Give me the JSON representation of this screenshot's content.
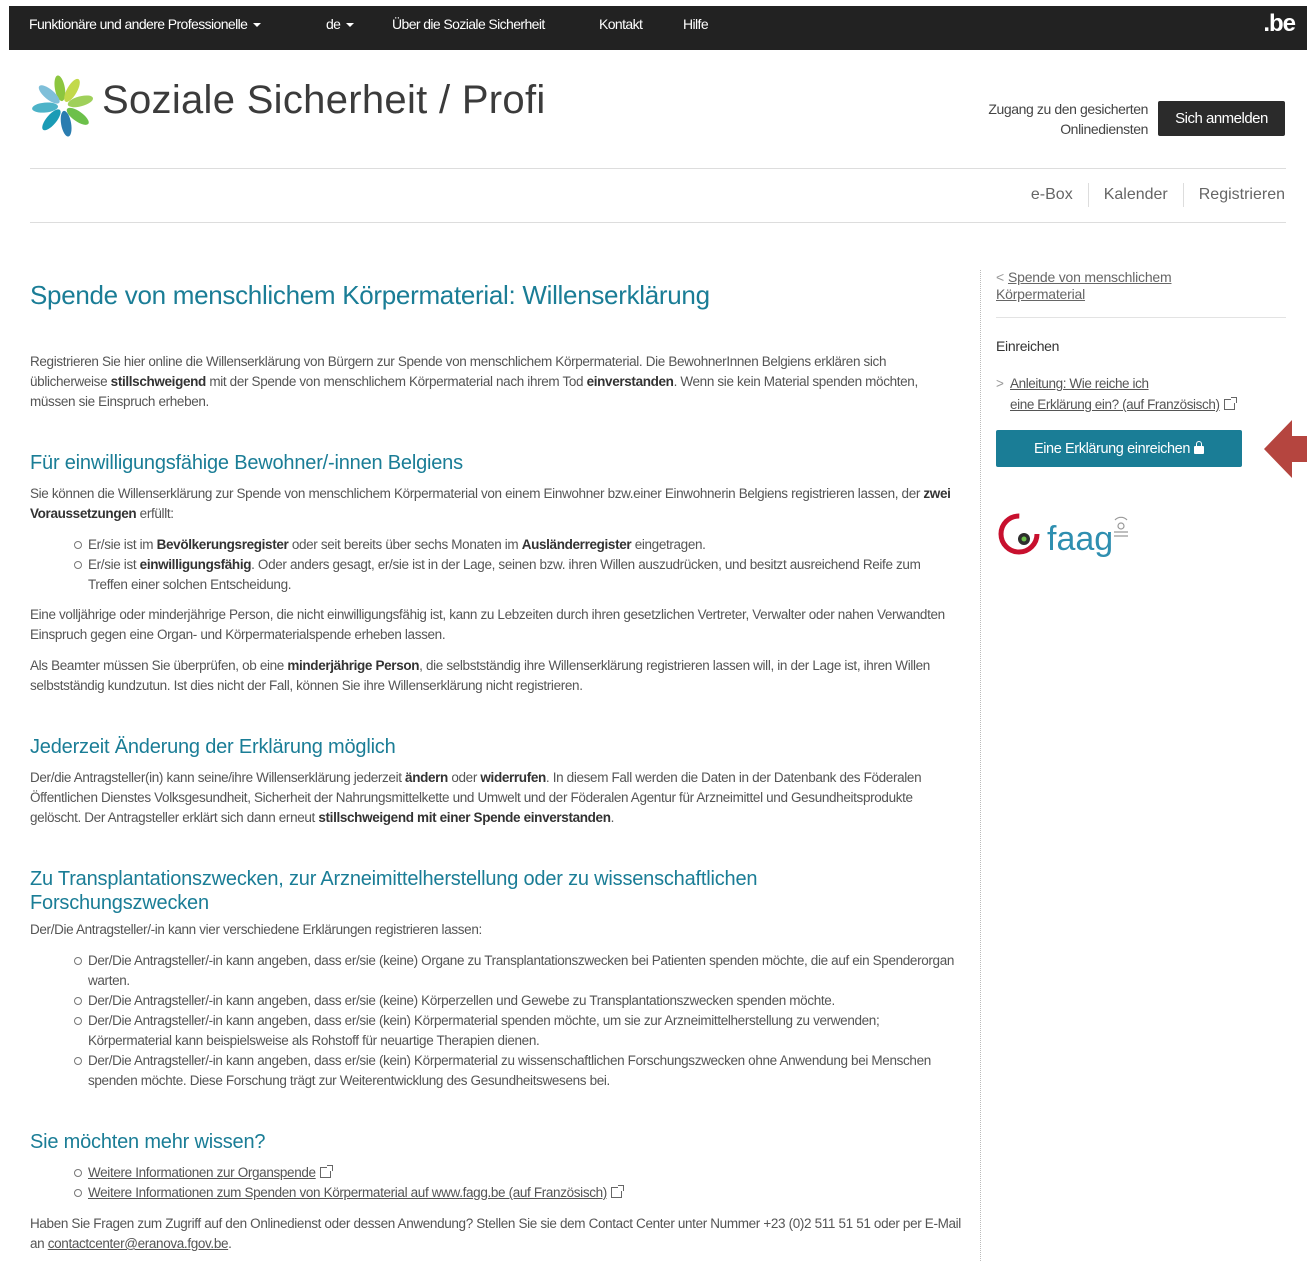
{
  "topbar": {
    "items": [
      {
        "label": "Funktionäre und andere Professionelle",
        "dropdown": true
      },
      {
        "label": "de",
        "dropdown": true
      },
      {
        "label": "Über die Soziale Sicherheit",
        "dropdown": false
      },
      {
        "label": "Kontakt",
        "dropdown": false
      },
      {
        "label": "Hilfe",
        "dropdown": false
      }
    ],
    "brand": ".be"
  },
  "header": {
    "title": "Soziale Sicherheit / Profi",
    "access_text_line1": "Zugang zu den gesicherten",
    "access_text_line2": "Onlinediensten",
    "login_label": "Sich anmelden"
  },
  "secondary_nav": [
    "e-Box",
    "Kalender",
    "Registrieren"
  ],
  "main": {
    "title": "Spende von menschlichem Körpermaterial: Willenserklärung",
    "intro": "Registrieren Sie hier online die Willenserklärung von Bürgern zur Spende von menschlichem Körpermaterial. Die BewohnerInnen Belgiens erklären sich üblicherweise stillschweigend mit der Spende von menschlichem Körpermaterial nach ihrem Tod einverstanden. Wenn sie kein Material spenden möchten, müssen sie Einspruch erheben.",
    "section1": {
      "heading": "Für einwilligungsfähige Bewohner/-innen Belgiens",
      "p1": "Sie können die Willenserklärung zur Spende von menschlichem Körpermaterial von einem Einwohner bzw.einer Einwohnerin Belgiens registrieren lassen, der zwei Voraussetzungen erfüllt:",
      "items": [
        "Er/sie ist im Bevölkerungsregister oder seit bereits über sechs Monaten im Ausländerregister eingetragen.",
        "Er/sie ist einwilligungsfähig. Oder anders gesagt, er/sie ist in der Lage, seinen bzw. ihren Willen auszudrücken, und besitzt ausreichend Reife zum Treffen einer solchen Entscheidung."
      ],
      "p2": "Eine volljährige oder minderjährige Person, die nicht einwilligungsfähig ist, kann zu Lebzeiten durch ihren gesetzlichen Vertreter, Verwalter oder nahen Verwandten Einspruch gegen eine Organ- und Körpermaterialspende erheben lassen.",
      "p3": "Als Beamter müssen Sie überprüfen, ob eine minderjährige Person, die selbstständig ihre Willenserklärung registrieren lassen will, in der Lage ist, ihren Willen selbstständig kundzutun. Ist dies nicht der Fall, können Sie ihre Willenserklärung nicht registrieren."
    },
    "section2": {
      "heading": "Jederzeit Änderung der Erklärung möglich",
      "p1": "Der/die Antragsteller(in) kann seine/ihre Willenserklärung jederzeit ändern oder widerrufen. In diesem Fall werden die Daten in der Datenbank des Föderalen Öffentlichen Dienstes Volksgesundheit, Sicherheit der Nahrungsmittelkette und Umwelt und der Föderalen Agentur für Arzneimittel und Gesundheitsprodukte gelöscht. Der Antragsteller erklärt sich dann erneut stillschweigend mit einer Spende einverstanden."
    },
    "section3": {
      "heading": "Zu Transplantationszwecken, zur Arzneimittelherstellung oder zu wissenschaftlichen Forschungszwecken",
      "p1": "Der/Die Antragsteller/-in kann vier verschiedene Erklärungen registrieren lassen:",
      "items": [
        "Der/Die Antragsteller/-in kann angeben, dass er/sie (keine) Organe zu Transplantationszwecken bei Patienten spenden möchte, die auf ein Spenderorgan warten.",
        "Der/Die Antragsteller/-in kann angeben, dass er/sie (keine) Körperzellen und Gewebe zu Transplantationszwecken spenden möchte.",
        "Der/Die Antragsteller/-in kann angeben, dass er/sie (kein) Körpermaterial spenden möchte, um sie zur Arzneimittelherstellung zu verwenden; Körpermaterial kann beispielsweise als Rohstoff für neuartige Therapien dienen.",
        "Der/Die Antragsteller/-in kann angeben, dass er/sie (kein) Körpermaterial zu wissenschaftlichen Forschungszwecken ohne Anwendung bei Menschen spenden möchte. Diese Forschung trägt zur Weiterentwicklung des Gesundheitswesens bei."
      ]
    },
    "section4": {
      "heading": "Sie möchten mehr wissen?",
      "links": [
        "Weitere Informationen zur Organspende",
        "Weitere Informationen zum Spenden von Körpermaterial auf www.fagg.be (auf Französisch)"
      ],
      "contact_text": "Haben Sie Fragen zum Zugriff auf den Onlinedienst oder dessen Anwendung? Stellen Sie sie dem Contact Center unter Nummer +23 (0)2 511 51 51 oder per E-Mail an",
      "contact_email": "contactcenter@eranova.fgov.be",
      "contact_end": "."
    }
  },
  "sidebar": {
    "back_link": "Spende von menschlichem Körpermaterial",
    "heading": "Einreichen",
    "guide_line1": "Anleitung: Wie reiche ich",
    "guide_line2": "eine Erklärung ein? (auf Französisch)",
    "submit_label": "Eine Erklärung einreichen",
    "partner_logo_text": "faag"
  },
  "colors": {
    "accent": "#1a7d96",
    "topbar": "#222222",
    "arrow": "#b5453f"
  }
}
